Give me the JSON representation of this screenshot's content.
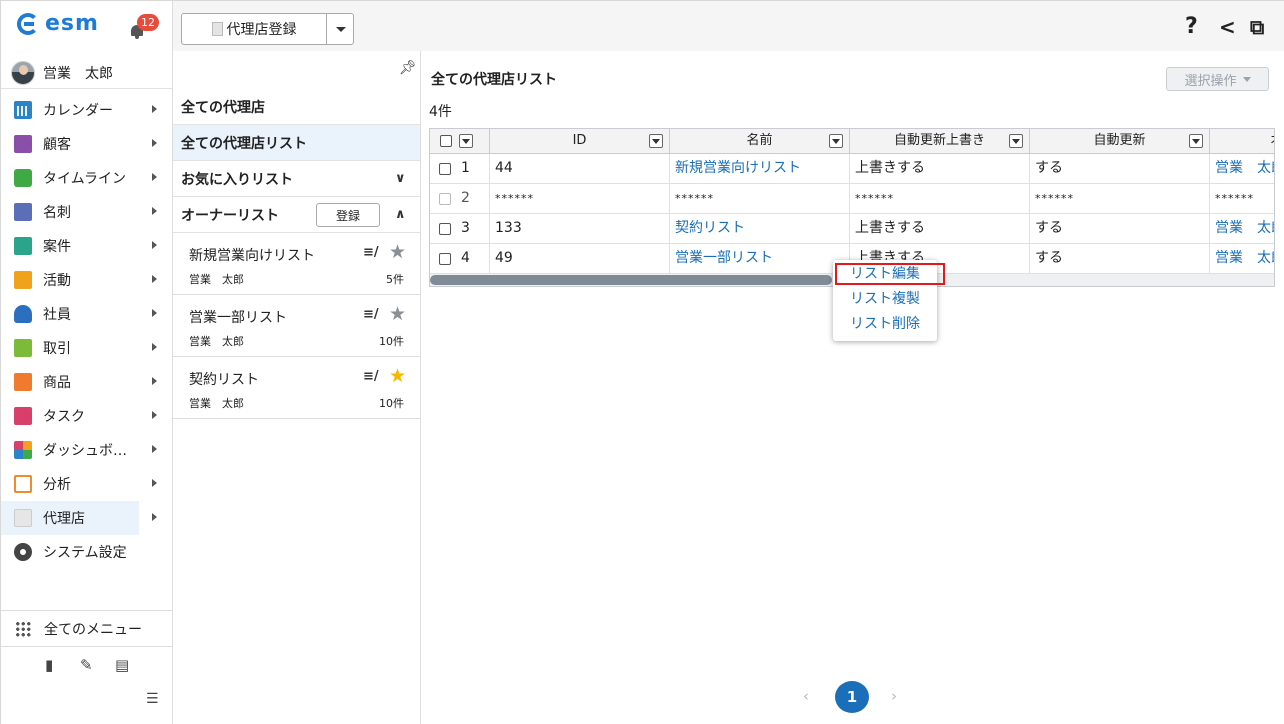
{
  "app": {
    "logo_text": "esm",
    "notification_count": "12",
    "user_name": "営業　太郎"
  },
  "sidebar": {
    "items": [
      {
        "label": "カレンダー",
        "icon": "calendar-icon"
      },
      {
        "label": "顧客",
        "icon": "customer-building-icon"
      },
      {
        "label": "タイムライン",
        "icon": "timeline-chat-icon"
      },
      {
        "label": "名刺",
        "icon": "business-card-icon"
      },
      {
        "label": "案件",
        "icon": "deal-folder-icon"
      },
      {
        "label": "活動",
        "icon": "activity-clipboard-icon"
      },
      {
        "label": "社員",
        "icon": "employee-person-icon"
      },
      {
        "label": "取引",
        "icon": "trade-note-icon"
      },
      {
        "label": "商品",
        "icon": "product-box-icon"
      },
      {
        "label": "タスク",
        "icon": "task-check-icon"
      },
      {
        "label": "ダッシュボ…",
        "icon": "dashboard-icon"
      },
      {
        "label": "分析",
        "icon": "analysis-chart-icon"
      },
      {
        "label": "代理店",
        "icon": "agency-doc-icon"
      },
      {
        "label": "システム設定",
        "icon": "gear-icon"
      }
    ],
    "all_menu_label": "全てのメニュー"
  },
  "toolbar": {
    "register_button_label": "代理店登録",
    "help_glyph": "?",
    "share_glyph": "<",
    "external_glyph": "⧉"
  },
  "list_panel": {
    "all_agencies": "全ての代理店",
    "all_agency_list": "全ての代理店リスト",
    "favorites": "お気に入りリスト",
    "owner_list": "オーナーリスト",
    "owner_register_button": "登録",
    "cards": [
      {
        "title": "新規営業向けリスト",
        "owner": "営業　太郎",
        "count": "5件",
        "favorite": false
      },
      {
        "title": "営業一部リスト",
        "owner": "営業　太郎",
        "count": "10件",
        "favorite": false
      },
      {
        "title": "契約リスト",
        "owner": "営業　太郎",
        "count": "10件",
        "favorite": true
      }
    ]
  },
  "main": {
    "title": "全ての代理店リスト",
    "count": "4件",
    "select_operation": "選択操作",
    "columns": [
      "ID",
      "名前",
      "自動更新上書き",
      "自動更新",
      "オ"
    ],
    "rows": [
      {
        "num": "1",
        "id": "44",
        "name": "新規営業向けリスト",
        "overwrite": "上書きする",
        "auto": "する",
        "owner": "営業　太郎"
      },
      {
        "num": "2",
        "id": "******",
        "name": "******",
        "overwrite": "******",
        "auto": "******",
        "owner": "******"
      },
      {
        "num": "3",
        "id": "133",
        "name": "契約リスト",
        "overwrite": "上書きする",
        "auto": "する",
        "owner": "営業　太郎"
      },
      {
        "num": "4",
        "id": "49",
        "name": "営業一部リスト",
        "overwrite": "上書きする",
        "auto": "する",
        "owner": "営業　太郎"
      }
    ],
    "context_menu": [
      "リスト編集",
      "リスト複製",
      "リスト削除"
    ],
    "pagination": {
      "current": "1",
      "prev": "‹",
      "next": "›"
    }
  },
  "colors": {
    "accent": "#1a6fb8",
    "active_bg": "#eaf3fb",
    "highlight_border": "#e01b1b",
    "favorite_star": "#f5b800"
  }
}
